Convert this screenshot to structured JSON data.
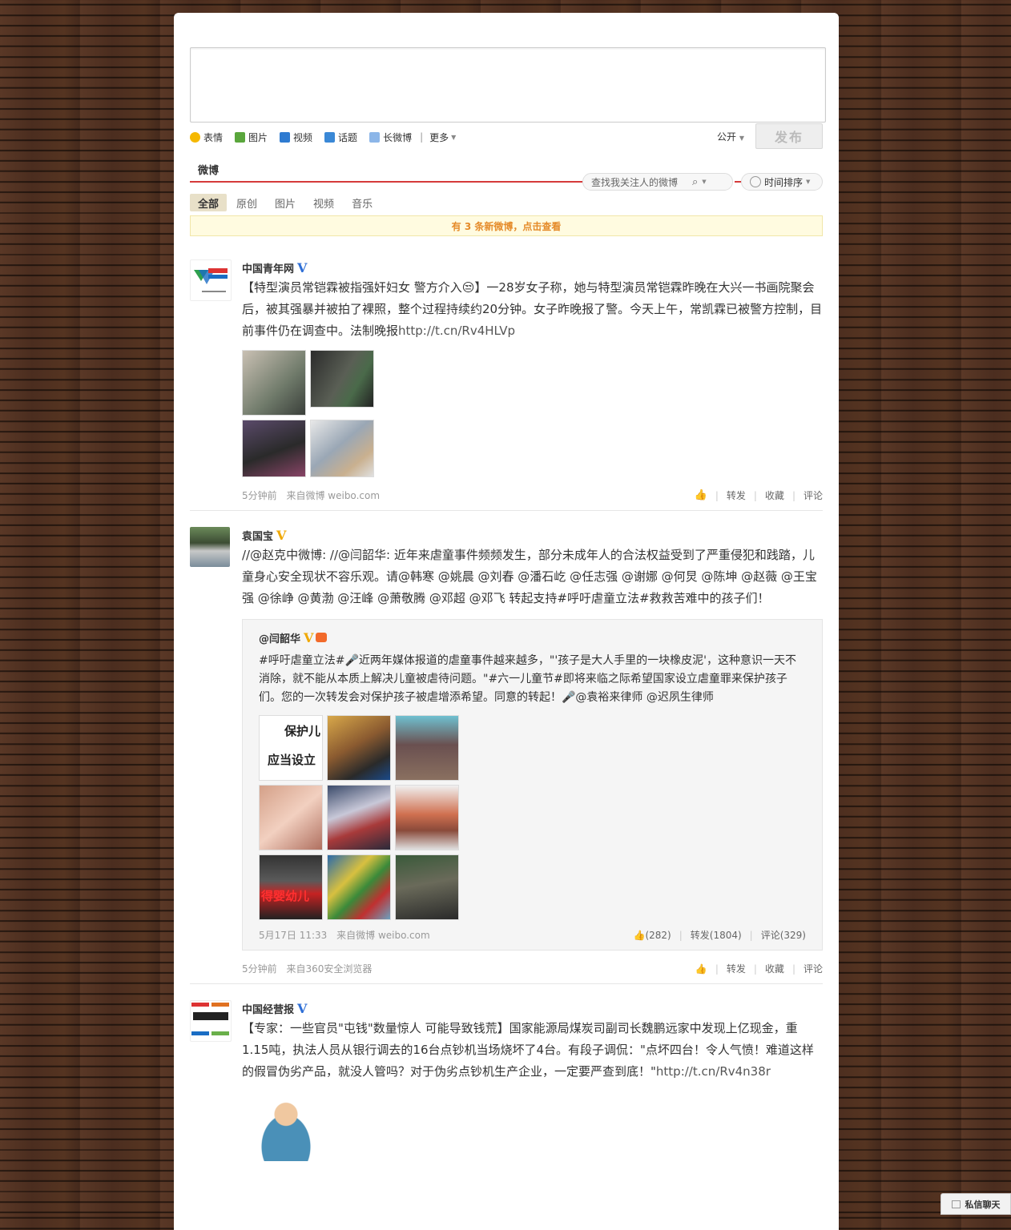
{
  "composer": {
    "placeholder": ""
  },
  "toolbar": {
    "items": [
      {
        "label": "表情",
        "icon": "smiley-icon",
        "color": "#f5b800"
      },
      {
        "label": "图片",
        "icon": "image-icon",
        "color": "#5aa63c"
      },
      {
        "label": "视频",
        "icon": "video-icon",
        "color": "#2f7bd1"
      },
      {
        "label": "话题",
        "icon": "topic-icon",
        "color": "#3a88d6"
      },
      {
        "label": "长微博",
        "icon": "longpost-icon",
        "color": "#3a88d6"
      }
    ],
    "more": "更多",
    "visibility": "公开",
    "publish": "发布"
  },
  "tabs": {
    "title": "微博",
    "search_placeholder": "查找我关注人的微博",
    "sort": "时间排序"
  },
  "filters": [
    "全部",
    "原创",
    "图片",
    "视频",
    "音乐"
  ],
  "new_posts_notice": "有 3 条新微博，点击查看",
  "posts": [
    {
      "name": "中国青年网",
      "verified_color": "#2f6fd6",
      "text_main": "【特型演员常铠霖被指强奸妇女 警方介入😒】一28岁女子称，她与特型演员常铠霖昨晚在大兴一书画院聚会后，被其强暴并被拍了裸照，整个过程持续约20分钟。女子昨晚报了警。今天上午，常凯霖已被警方控制，目前事件仍在调查中。法制晚报",
      "link": "http://t.cn/Rv4HLVp",
      "time": "5分钟前",
      "source": "来自微博 weibo.com",
      "actions": [
        "转发",
        "收藏",
        "评论"
      ]
    },
    {
      "name": "袁国宝",
      "verified_color": "#f0a800",
      "text_main": "//@赵克中微博: //@闫韶华: 近年来虐童事件频频发生，部分未成年人的合法权益受到了严重侵犯和践踏，儿童身心安全现状不容乐观。请@韩寒 @姚晨 @刘春 @潘石屹 @任志强 @谢娜 @何炅 @陈坤 @赵薇 @王宝强 @徐峥 @黄渤 @汪峰 @萧敬腾 @邓超 @邓飞 转起支持#呼吁虐童立法#救救苦难中的孩子们！",
      "quote": {
        "name": "@闫韶华",
        "text": "#呼吁虐童立法#🎤近两年媒体报道的虐童事件越来越多，\"'孩子是大人手里的一块橡皮泥'，这种意识一天不消除，就不能从本质上解决儿童被虐待问题。\"#六一儿童节#即将来临之际希望国家设立虐童罪来保护孩子们。您的一次转发会对保护孩子被虐增添希望。同意的转起！🎤@袁裕来律师 @迟夙生律师",
        "img_caption_1": "保护儿",
        "img_caption_2": "应当设立",
        "img_caption_3": "得婴幼儿",
        "time": "5月17日 11:33",
        "source": "来自微博 weibo.com",
        "likes": "(282)",
        "reposts": "转发(1804)",
        "comments": "评论(329)"
      },
      "time": "5分钟前",
      "source": "来自360安全浏览器",
      "actions": [
        "转发",
        "收藏",
        "评论"
      ]
    },
    {
      "name": "中国经营报",
      "verified_color": "#2f6fd6",
      "text_main": "【专家：一些官员\"屯钱\"数量惊人 可能导致钱荒】国家能源局煤炭司副司长魏鹏远家中发现上亿现金，重1.15吨，执法人员从银行调去的16台点钞机当场烧坏了4台。有段子调侃：\"点坏四台！令人气愤！难道这样的假冒伪劣产品，就没人管吗？对于伪劣点钞机生产企业，一定要严查到底！\"",
      "link": "http://t.cn/Rv4n38r"
    }
  ],
  "chat_label": "私信聊天"
}
